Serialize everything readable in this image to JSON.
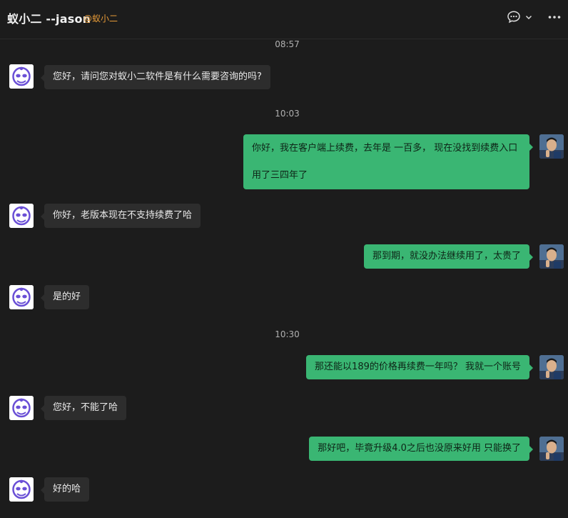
{
  "header": {
    "title": "蚁小二 --jason",
    "subtitle": "@蚁小二",
    "icons": [
      "chat-icon",
      "chevron-down-icon",
      "more-icon"
    ]
  },
  "colors": {
    "background": "#1c1c1c",
    "bubble_incoming": "#2d2d2d",
    "bubble_outgoing": "#3ab673",
    "accent_subtitle": "#e69a37"
  },
  "messages": [
    {
      "type": "time",
      "text": "08:57"
    },
    {
      "type": "incoming",
      "text": "您好，请问您对蚁小二软件是有什么需要咨询的吗?"
    },
    {
      "type": "time",
      "text": "10:03"
    },
    {
      "type": "outgoing",
      "line1": "你好，我在客户端上续费，去年是 一百多， 现在没找到续费入口",
      "line2": "用了三四年了"
    },
    {
      "type": "incoming",
      "text": "你好，老版本现在不支持续费了哈"
    },
    {
      "type": "outgoing",
      "text": "那到期，就没办法继续用了，太贵了"
    },
    {
      "type": "incoming",
      "text": "是的好"
    },
    {
      "type": "time",
      "text": "10:30"
    },
    {
      "type": "outgoing",
      "text": "那还能以189的价格再续费一年吗？ 我就一个账号"
    },
    {
      "type": "incoming",
      "text": "您好，不能了哈"
    },
    {
      "type": "outgoing",
      "text": "那好吧，毕竟升级4.0之后也没原来好用 只能换了"
    },
    {
      "type": "incoming",
      "text": "好的哈"
    }
  ]
}
